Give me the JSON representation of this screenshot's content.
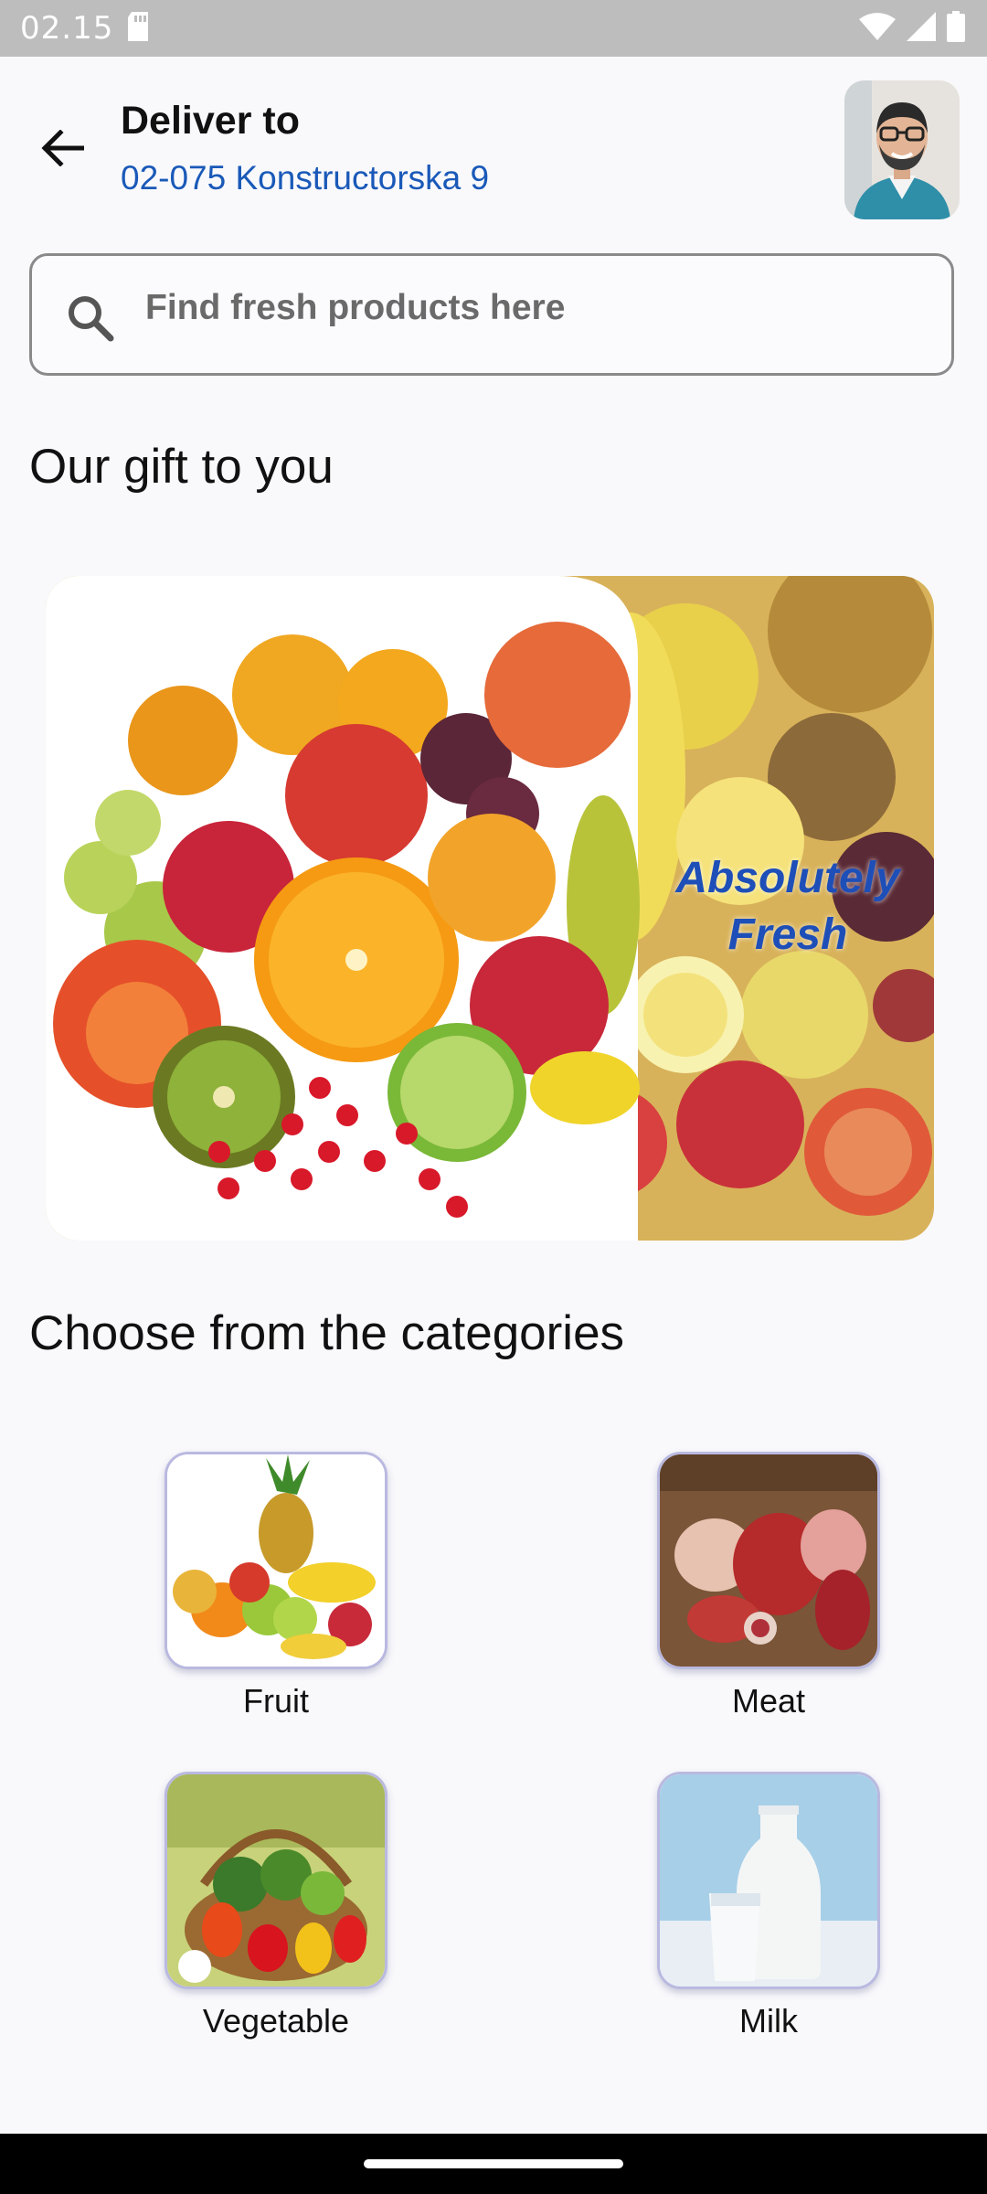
{
  "status_bar": {
    "time": "02.15"
  },
  "header": {
    "deliver_label": "Deliver to",
    "address": "02-075 Konstructorska 9"
  },
  "search": {
    "placeholder": "Find fresh products here"
  },
  "gift_section": {
    "title": "Our gift to you",
    "banner_text_line1": "Absolutely",
    "banner_text_line2": "Fresh"
  },
  "categories_section": {
    "title": "Choose from the categories",
    "items": [
      {
        "label": "Fruit"
      },
      {
        "label": "Meat"
      },
      {
        "label": "Vegetable"
      },
      {
        "label": "Milk"
      }
    ]
  },
  "colors": {
    "accent_blue": "#1a59b8",
    "background": "#f9f9fc",
    "status_bar": "#bdbdbd"
  }
}
